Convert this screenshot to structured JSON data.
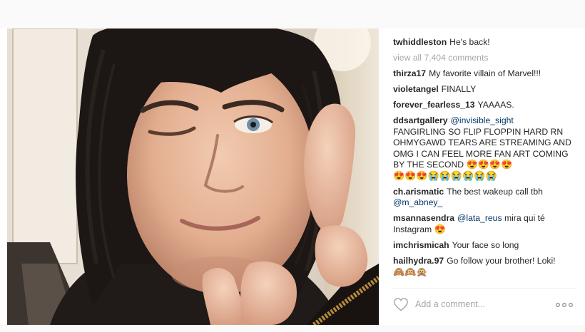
{
  "post": {
    "photo": {
      "alt": "Selfie of a man with long dark hair winking and pointing at the camera"
    },
    "caption": {
      "user": "twhiddleston",
      "text": "He's back!"
    },
    "view_all": "view all 7,404 comments",
    "comments": [
      {
        "user": "thirza17",
        "text": "My favorite villain of Marvel!!!"
      },
      {
        "user": "violetangel",
        "text": "FINALLY"
      },
      {
        "user": "forever_fearless_13",
        "text": "YAAAAS."
      },
      {
        "user": "ddsartgallery",
        "mention": "@invisible_sight",
        "text": "FANGIRLING SO FLIP FLOPPIN HARD RN OHMYGAWD TEARS ARE STREAMING AND OMG I CAN FEEL MORE FAN ART COMING BY THE SECOND",
        "emojis_inline": "😍😍😍😍",
        "emojis_line2": "😍😍😍😭😭😭😭😭😭"
      },
      {
        "user": "ch.arismatic",
        "text": "The best wakeup call tbh",
        "mention": "@m_abney_"
      },
      {
        "user": "msannasendra",
        "mention": "@lata_reus",
        "text": "mira qui té Instagram",
        "emojis": "😍"
      },
      {
        "user": "imchrismicah",
        "text": "Your face so long"
      },
      {
        "user": "hailhydra.97",
        "text": "Go follow your brother! Loki!",
        "emojis": "🙈🙉🙊"
      }
    ],
    "footer": {
      "add_comment_placeholder": "Add a comment...",
      "like_icon": "heart-icon",
      "more_icon": "more-options-icon"
    }
  },
  "colors": {
    "text": "#262626",
    "muted": "#a5a7aa",
    "mention": "#003569",
    "divider": "#efefef"
  }
}
